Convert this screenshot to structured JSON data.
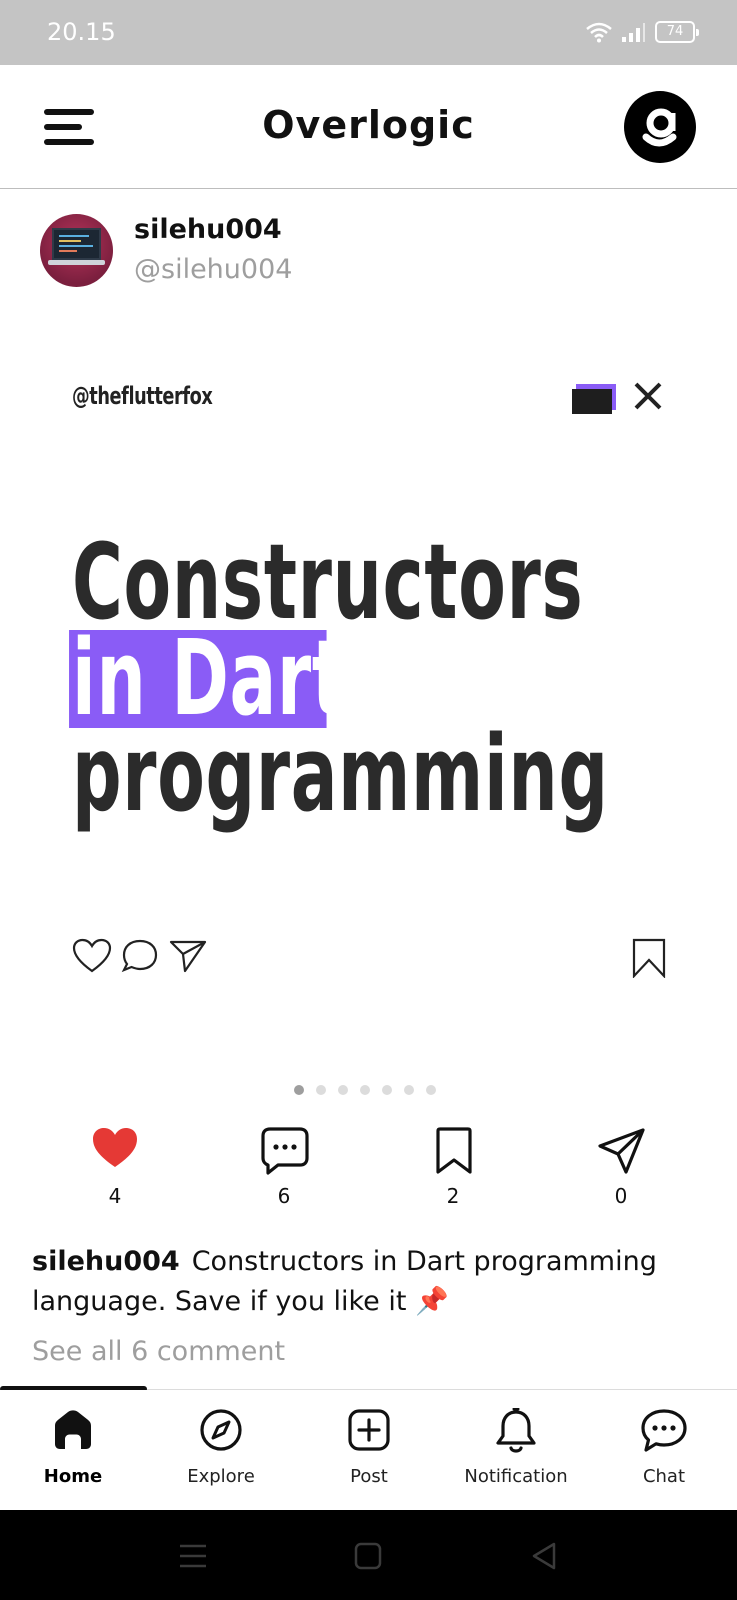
{
  "status_bar": {
    "time": "20.15",
    "battery": "74"
  },
  "app_bar": {
    "title": "Overlogic",
    "logo_letter": "g"
  },
  "post": {
    "username": "silehu004",
    "handle": "@silehu004",
    "image": {
      "handle": "@theflutterfox",
      "headline_line1": "Constructors",
      "headline_line2": "in Dart",
      "headline_line3": "programming",
      "accent_color": "#8a5cf6",
      "carousel_total": 7,
      "carousel_index": 1
    },
    "reactions": {
      "likes": "4",
      "comments": "6",
      "bookmarks": "2",
      "shares": "0",
      "like_color": "#e53935"
    },
    "caption_user": "silehu004",
    "caption_text": "Constructors in Dart programming language. Save if you like it 📌",
    "see_comments": "See all 6 comment"
  },
  "bottom_nav": {
    "items": [
      {
        "label": "Home",
        "icon": "home-icon",
        "active": true
      },
      {
        "label": "Explore",
        "icon": "compass-icon",
        "active": false
      },
      {
        "label": "Post",
        "icon": "plus-square-icon",
        "active": false
      },
      {
        "label": "Notification",
        "icon": "bell-icon",
        "active": false
      },
      {
        "label": "Chat",
        "icon": "chat-icon",
        "active": false
      }
    ]
  },
  "system_nav": {
    "icons": [
      "menu-icon",
      "home-square-icon",
      "back-triangle-icon"
    ]
  }
}
